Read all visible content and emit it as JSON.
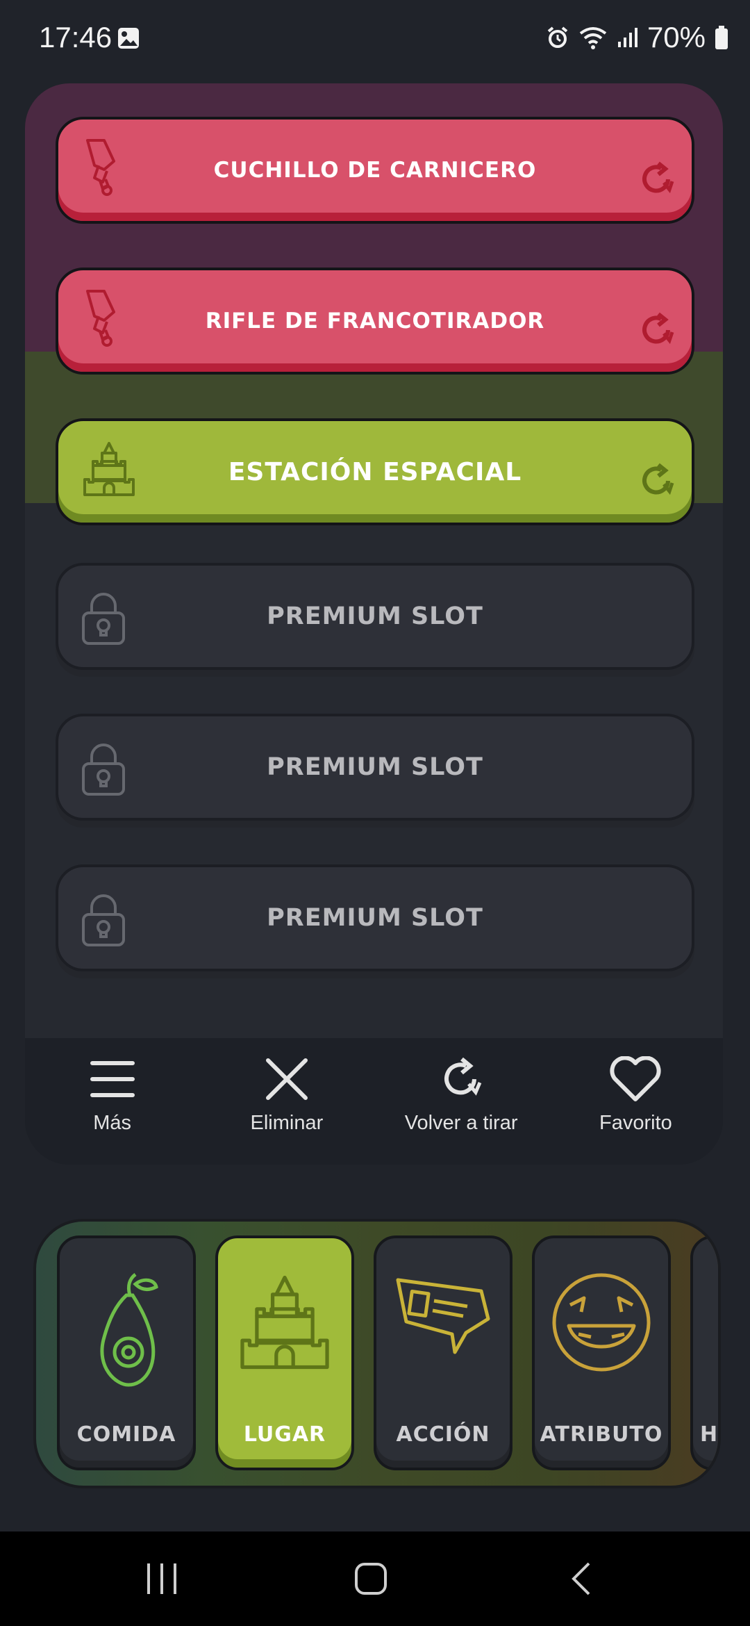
{
  "status": {
    "time": "17:46",
    "battery": "70%"
  },
  "slots": [
    {
      "label": "CUCHILLO DE CARNICERO",
      "category_icon": "sword-icon",
      "color": "#d8516a"
    },
    {
      "label": "RIFLE DE FRANCOTIRADOR",
      "category_icon": "sword-icon",
      "color": "#d8516a"
    },
    {
      "label": "ESTACIÓN ESPACIAL",
      "category_icon": "castle-icon",
      "color": "#9fb83b"
    },
    {
      "label": "PREMIUM SLOT",
      "category_icon": "lock-icon",
      "color": "#2e3038"
    },
    {
      "label": "PREMIUM SLOT",
      "category_icon": "lock-icon",
      "color": "#2e3038"
    },
    {
      "label": "PREMIUM SLOT",
      "category_icon": "lock-icon",
      "color": "#2e3038"
    }
  ],
  "actions": {
    "more": "Más",
    "delete": "Eliminar",
    "reroll": "Volver a tirar",
    "favorite": "Favorito"
  },
  "categories": [
    {
      "label": "COMIDA",
      "icon": "avocado-icon",
      "active": false
    },
    {
      "label": "LUGAR",
      "icon": "castle-icon",
      "active": true
    },
    {
      "label": "ACCIÓN",
      "icon": "ticket-icon",
      "active": false
    },
    {
      "label": "ATRIBUTO",
      "icon": "laughing-face-icon",
      "active": false
    },
    {
      "label": "H",
      "icon": "partial-icon",
      "active": false
    }
  ],
  "colors": {
    "accent_red": "#d8516a",
    "accent_green": "#9fb83b",
    "background": "#20232a"
  }
}
